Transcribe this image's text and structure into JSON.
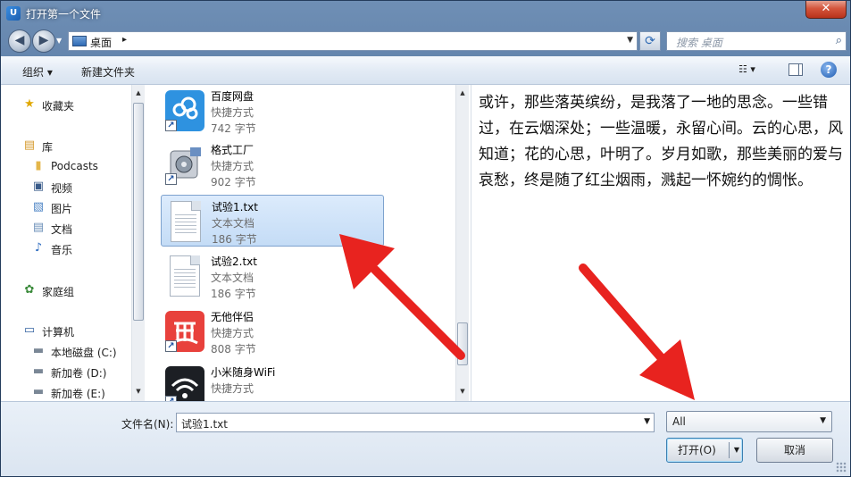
{
  "window": {
    "title": "打开第一个文件",
    "app_icon_text": "U",
    "close_symbol": "✕"
  },
  "address": {
    "location": "桌面",
    "chevron": "▸",
    "search_placeholder": "搜索 桌面"
  },
  "toolbar": {
    "organize": "组织 ▾",
    "new_folder": "新建文件夹",
    "view_symbol": "☷ ▾",
    "help": "?"
  },
  "nav": {
    "items": [
      {
        "label": "收藏夹",
        "icon": "favorites-star-icon",
        "glyph": "★"
      },
      {
        "label": "库",
        "icon": "library-icon",
        "glyph": "▤"
      },
      {
        "label": "Podcasts",
        "icon": "folder-icon",
        "glyph": "▮"
      },
      {
        "label": "视频",
        "icon": "video-icon",
        "glyph": "▣"
      },
      {
        "label": "图片",
        "icon": "picture-icon",
        "glyph": "▧"
      },
      {
        "label": "文档",
        "icon": "document-icon",
        "glyph": "▤"
      },
      {
        "label": "音乐",
        "icon": "music-icon",
        "glyph": "♪"
      },
      {
        "label": "家庭组",
        "icon": "homegroup-icon",
        "glyph": "✿"
      },
      {
        "label": "计算机",
        "icon": "computer-icon",
        "glyph": "▭"
      },
      {
        "label": "本地磁盘 (C:)",
        "icon": "drive-c-icon",
        "glyph": "▬"
      },
      {
        "label": "新加卷 (D:)",
        "icon": "drive-d-icon",
        "glyph": "▬"
      },
      {
        "label": "新加卷 (E:)",
        "icon": "drive-e-icon",
        "glyph": "▬"
      }
    ]
  },
  "files": [
    {
      "name": "百度网盘",
      "type": "快捷方式",
      "size": "742 字节",
      "icon": "baidu-netdisk-icon"
    },
    {
      "name": "格式工厂",
      "type": "快捷方式",
      "size": "902 字节",
      "icon": "format-factory-icon"
    },
    {
      "name": "试验1.txt",
      "type": "文本文档",
      "size": "186 字节",
      "icon": "text-file-icon"
    },
    {
      "name": "试验2.txt",
      "type": "文本文档",
      "size": "186 字节",
      "icon": "text-file-icon"
    },
    {
      "name": "无他伴侣",
      "type": "快捷方式",
      "size": "808 字节",
      "icon": "wuta-icon"
    },
    {
      "name": "小米随身WiFi",
      "type": "快捷方式",
      "size": "",
      "icon": "xiaomi-wifi-icon"
    }
  ],
  "preview": {
    "text": "或许，那些落英缤纷，是我落了一地的思念。一些错过，在云烟深处；一些温暖，永留心间。云的心思，风知道；花的心思，叶明了。岁月如歌，那些美丽的爱与哀愁，终是随了红尘烟雨，溅起一怀婉约的惆怅。"
  },
  "footer": {
    "filename_label": "文件名(N):",
    "filename_value": "试验1.txt",
    "filter_value": "All",
    "open_button": "打开(O)",
    "cancel_button": "取消"
  },
  "colors": {
    "annotation_arrow": "#e8231f",
    "selection": "#c4dcf6",
    "frame": "#4b6e9a"
  }
}
